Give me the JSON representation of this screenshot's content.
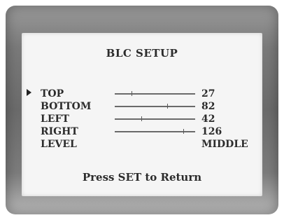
{
  "menu": {
    "title": "BLC SETUP",
    "items": [
      {
        "label": "TOP",
        "value": "27",
        "selected": true,
        "level": 0.21
      },
      {
        "label": "BOTTOM",
        "value": "82",
        "selected": false,
        "level": 0.65
      },
      {
        "label": "LEFT",
        "value": "42",
        "selected": false,
        "level": 0.33
      },
      {
        "label": "RIGHT",
        "value": "126",
        "selected": false,
        "level": 0.85
      },
      {
        "label": "LEVEL",
        "value": "MIDDLE",
        "selected": false
      }
    ],
    "footer": "Press SET to Return"
  }
}
